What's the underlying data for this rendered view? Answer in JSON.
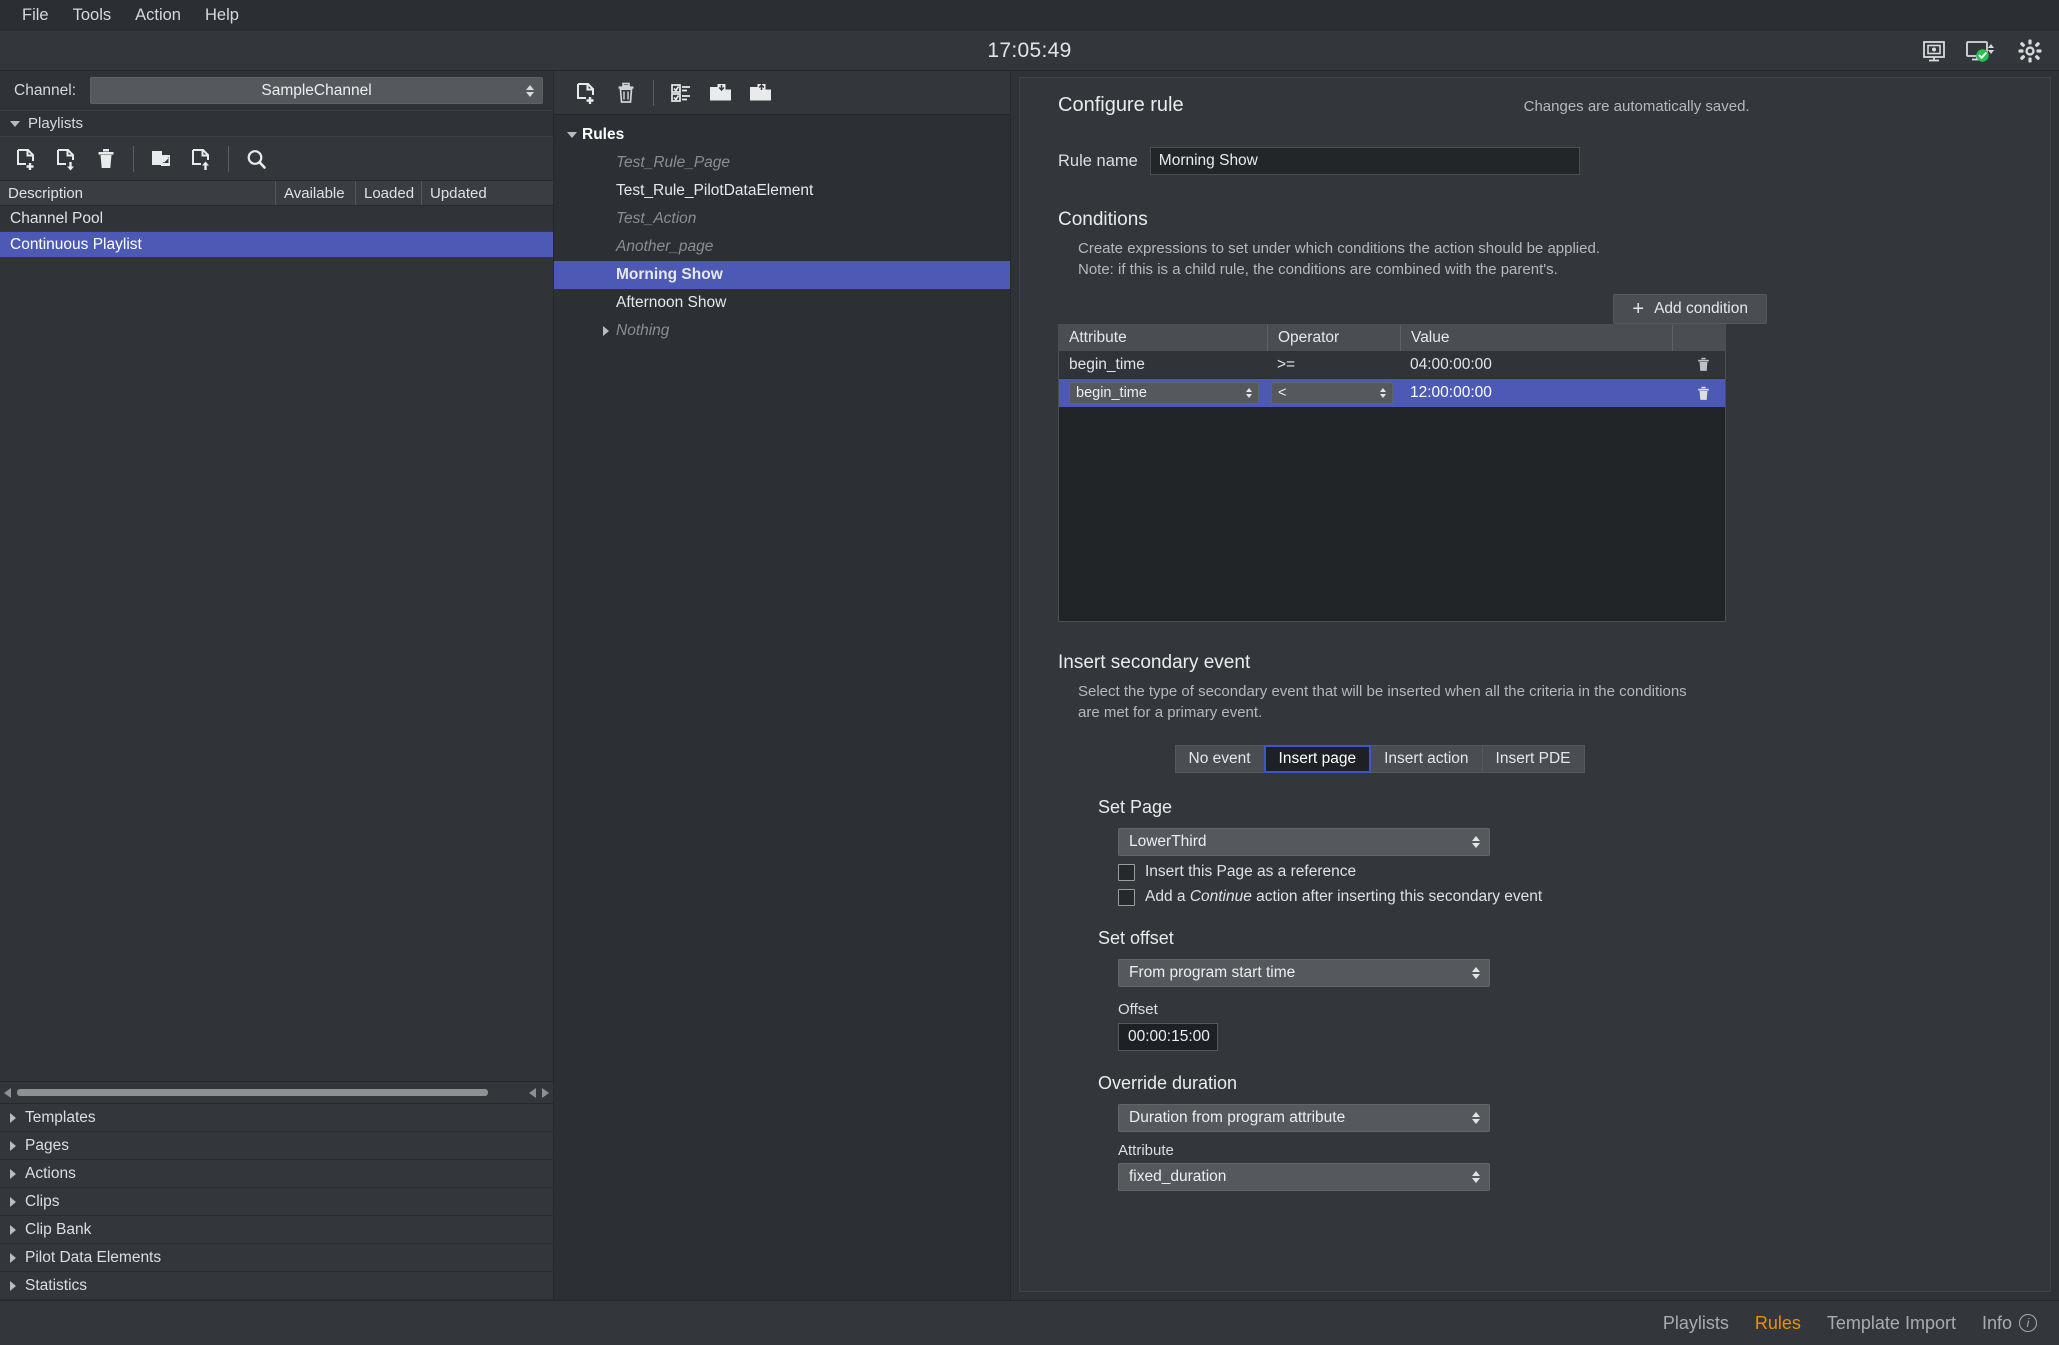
{
  "menu": {
    "items": [
      {
        "label": "File"
      },
      {
        "label": "Tools"
      },
      {
        "label": "Action"
      },
      {
        "label": "Help"
      }
    ]
  },
  "titlebar": {
    "clock": "17:05:49",
    "icons": [
      {
        "name": "monitor-settings-icon"
      },
      {
        "name": "monitor-status-ok-icon"
      },
      {
        "name": "gear-icon"
      }
    ]
  },
  "left_panel": {
    "channel": {
      "label": "Channel:",
      "value": "SampleChannel"
    },
    "playlists_section": {
      "label": "Playlists"
    },
    "toolbar": [
      {
        "name": "new-playlist-icon"
      },
      {
        "name": "import-playlist-icon"
      },
      {
        "name": "delete-playlist-icon"
      },
      {
        "name": "duplicate-playlist-icon"
      },
      {
        "name": "export-playlist-icon"
      },
      {
        "name": "search-icon"
      }
    ],
    "table": {
      "columns": [
        "Description",
        "Available",
        "Loaded",
        "Updated"
      ],
      "rows": [
        {
          "description": "Channel Pool",
          "available": "",
          "loaded": "",
          "updated": "",
          "selected": false
        },
        {
          "description": "Continuous Playlist",
          "available": "",
          "loaded": "",
          "updated": "",
          "selected": true
        }
      ]
    },
    "accordion": [
      {
        "label": "Templates"
      },
      {
        "label": "Pages"
      },
      {
        "label": "Actions"
      },
      {
        "label": "Clips"
      },
      {
        "label": "Clip Bank"
      },
      {
        "label": "Pilot Data Elements"
      },
      {
        "label": "Statistics"
      }
    ]
  },
  "rules_panel": {
    "toolbar": [
      {
        "name": "new-rule-icon"
      },
      {
        "name": "delete-rule-icon"
      },
      {
        "name": "checklist-icon"
      },
      {
        "name": "import-rules-icon"
      },
      {
        "name": "export-rules-icon"
      }
    ],
    "tree": {
      "root": "Rules",
      "items": [
        {
          "label": "Test_Rule_Page",
          "style": "dim",
          "selected": false,
          "group": false
        },
        {
          "label": "Test_Rule_PilotDataElement",
          "style": "normal",
          "selected": false,
          "group": false
        },
        {
          "label": "Test_Action",
          "style": "dim",
          "selected": false,
          "group": false
        },
        {
          "label": "Another_page",
          "style": "dim",
          "selected": false,
          "group": false
        },
        {
          "label": "Morning Show",
          "style": "normal",
          "selected": true,
          "group": false
        },
        {
          "label": "Afternoon Show",
          "style": "normal",
          "selected": false,
          "group": false
        },
        {
          "label": "Nothing",
          "style": "dim",
          "selected": false,
          "group": true
        }
      ]
    }
  },
  "configure": {
    "title": "Configure rule",
    "saved_note": "Changes are automatically saved.",
    "rule_name_label": "Rule name",
    "rule_name_value": "Morning Show",
    "conditions": {
      "title": "Conditions",
      "desc_line1": "Create expressions to set under which conditions the action should be applied.",
      "desc_line2": "Note: if this is a child rule, the conditions are combined with the parent's.",
      "add_button": "Add condition",
      "columns": [
        "Attribute",
        "Operator",
        "Value"
      ],
      "rows": [
        {
          "attribute": "begin_time",
          "operator": ">=",
          "value": "04:00:00:00",
          "selected": false
        },
        {
          "attribute": "begin_time",
          "operator": "<",
          "value": "12:00:00:00",
          "selected": true
        }
      ]
    },
    "secondary_event": {
      "title": "Insert secondary event",
      "desc_line1": "Select the type of secondary event that will be inserted when all the criteria in the conditions",
      "desc_line2": "are met for a primary event.",
      "tabs": [
        {
          "label": "No event",
          "active": false
        },
        {
          "label": "Insert page",
          "active": true
        },
        {
          "label": "Insert action",
          "active": false
        },
        {
          "label": "Insert PDE",
          "active": false
        }
      ]
    },
    "set_page": {
      "title": "Set Page",
      "page_value": "LowerThird",
      "checkbox_reference": "Insert this Page as a reference",
      "checkbox_continue_pre": "Add a ",
      "checkbox_continue_em": "Continue",
      "checkbox_continue_post": " action after inserting this secondary event"
    },
    "set_offset": {
      "title": "Set offset",
      "mode_value": "From program start time",
      "offset_label": "Offset",
      "offset_value": "00:00:15:00"
    },
    "override_duration": {
      "title": "Override duration",
      "mode_value": "Duration from program attribute",
      "attribute_label": "Attribute",
      "attribute_value": "fixed_duration"
    }
  },
  "statusbar": {
    "nav": [
      {
        "label": "Playlists",
        "active": false
      },
      {
        "label": "Rules",
        "active": true
      },
      {
        "label": "Template Import",
        "active": false
      },
      {
        "label": "Info",
        "active": false
      }
    ]
  },
  "colors": {
    "selection_blue": "#4c5ab5",
    "accent_orange": "#e8900c",
    "status_green": "#24c24a",
    "focus_border": "#3c58c8"
  }
}
